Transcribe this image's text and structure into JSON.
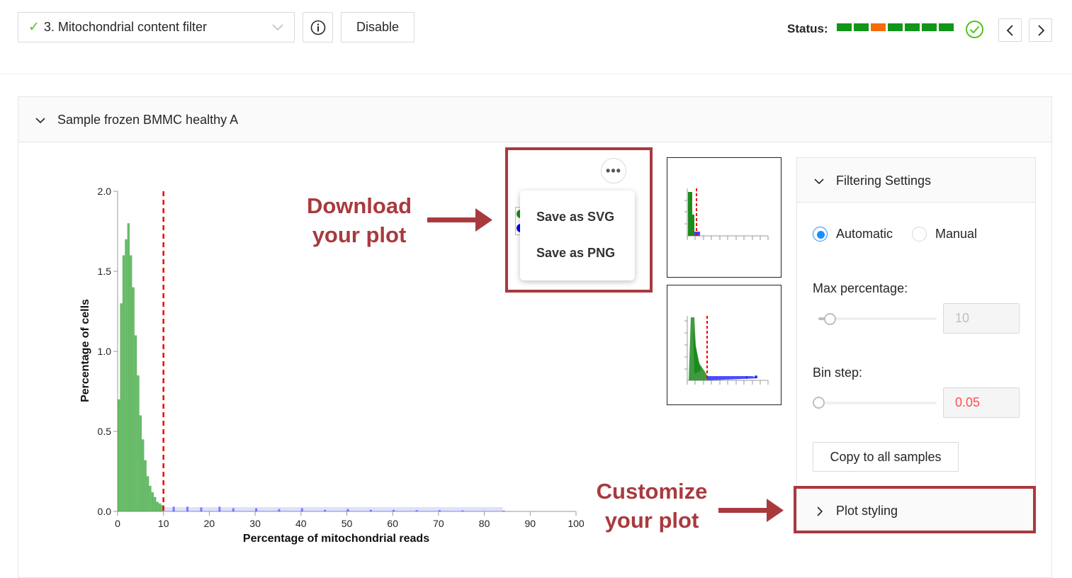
{
  "header": {
    "step_label": "3. Mitochondrial content filter",
    "disable_label": "Disable",
    "status_label": "Status:",
    "status_colors": [
      "#109618",
      "#109618",
      "#f46b0b",
      "#109618",
      "#109618",
      "#109618",
      "#109618"
    ],
    "status_ok_color": "#52c41a"
  },
  "panel": {
    "sample_title": "Sample frozen BMMC healthy A"
  },
  "plot_menu": {
    "save_svg": "Save as SVG",
    "save_png": "Save as PNG"
  },
  "annotations": {
    "download_line1": "Download",
    "download_line2": "your plot",
    "customize_line1": "Customize",
    "customize_line2": "your plot"
  },
  "settings": {
    "title": "Filtering Settings",
    "automatic_label": "Automatic",
    "manual_label": "Manual",
    "mode": "Automatic",
    "max_percentage_label": "Max percentage:",
    "max_percentage_value": "10",
    "bin_step_label": "Bin step:",
    "bin_step_value": "0.05",
    "copy_label": "Copy to all samples",
    "plot_styling_label": "Plot styling"
  },
  "chart_data": {
    "type": "bar",
    "xlabel": "Percentage of mitochondrial reads",
    "ylabel": "Percentage of cells",
    "xlim": [
      0,
      100
    ],
    "ylim": [
      0,
      2.0
    ],
    "x_ticks": [
      "0",
      "10",
      "20",
      "30",
      "40",
      "50",
      "60",
      "70",
      "80",
      "90",
      "100"
    ],
    "y_ticks": [
      "0.0",
      "0.5",
      "1.0",
      "1.5",
      "2.0"
    ],
    "threshold": 10,
    "series": [
      {
        "color": "#2ca02c",
        "range": [
          0,
          10
        ],
        "x": [
          0.5,
          1,
          1.5,
          2,
          2.5,
          3,
          3.5,
          4,
          4.5,
          5,
          5.5,
          6,
          6.5,
          7,
          7.5,
          8,
          8.5,
          9,
          9.5
        ],
        "values": [
          0.7,
          1.3,
          1.6,
          1.7,
          1.8,
          1.6,
          1.4,
          1.1,
          0.85,
          0.6,
          0.45,
          0.32,
          0.22,
          0.16,
          0.12,
          0.09,
          0.06,
          0.05,
          0.04
        ]
      },
      {
        "color": "#0000ff",
        "range": [
          10,
          84
        ],
        "x": [
          12,
          15,
          18,
          22,
          25,
          30,
          35,
          40,
          45,
          50,
          55,
          60,
          65,
          70,
          75,
          84
        ],
        "values": [
          0.03,
          0.03,
          0.025,
          0.03,
          0.02,
          0.02,
          0.015,
          0.02,
          0.01,
          0.015,
          0.01,
          0.01,
          0.008,
          0.008,
          0.006,
          0.005
        ]
      }
    ]
  }
}
